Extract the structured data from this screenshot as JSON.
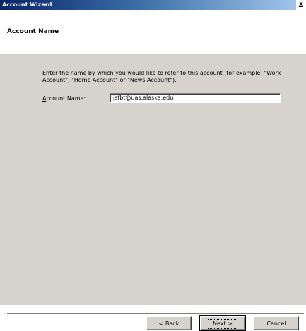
{
  "window": {
    "title": "Account Wizard",
    "close_glyph": "x"
  },
  "header": {
    "heading": "Account Name"
  },
  "main": {
    "description": "Enter the name by which you would like to refer to this account (for example, \"Work Account\", \"Home Account\" or \"News Account\").",
    "account_name_label_accesskey": "A",
    "account_name_label_rest": "ccount Name:",
    "account_name_value": "jsfbt@uas.alaska.edu"
  },
  "buttons": {
    "back": "< Back",
    "next": "Next >",
    "cancel": "Cancel"
  }
}
